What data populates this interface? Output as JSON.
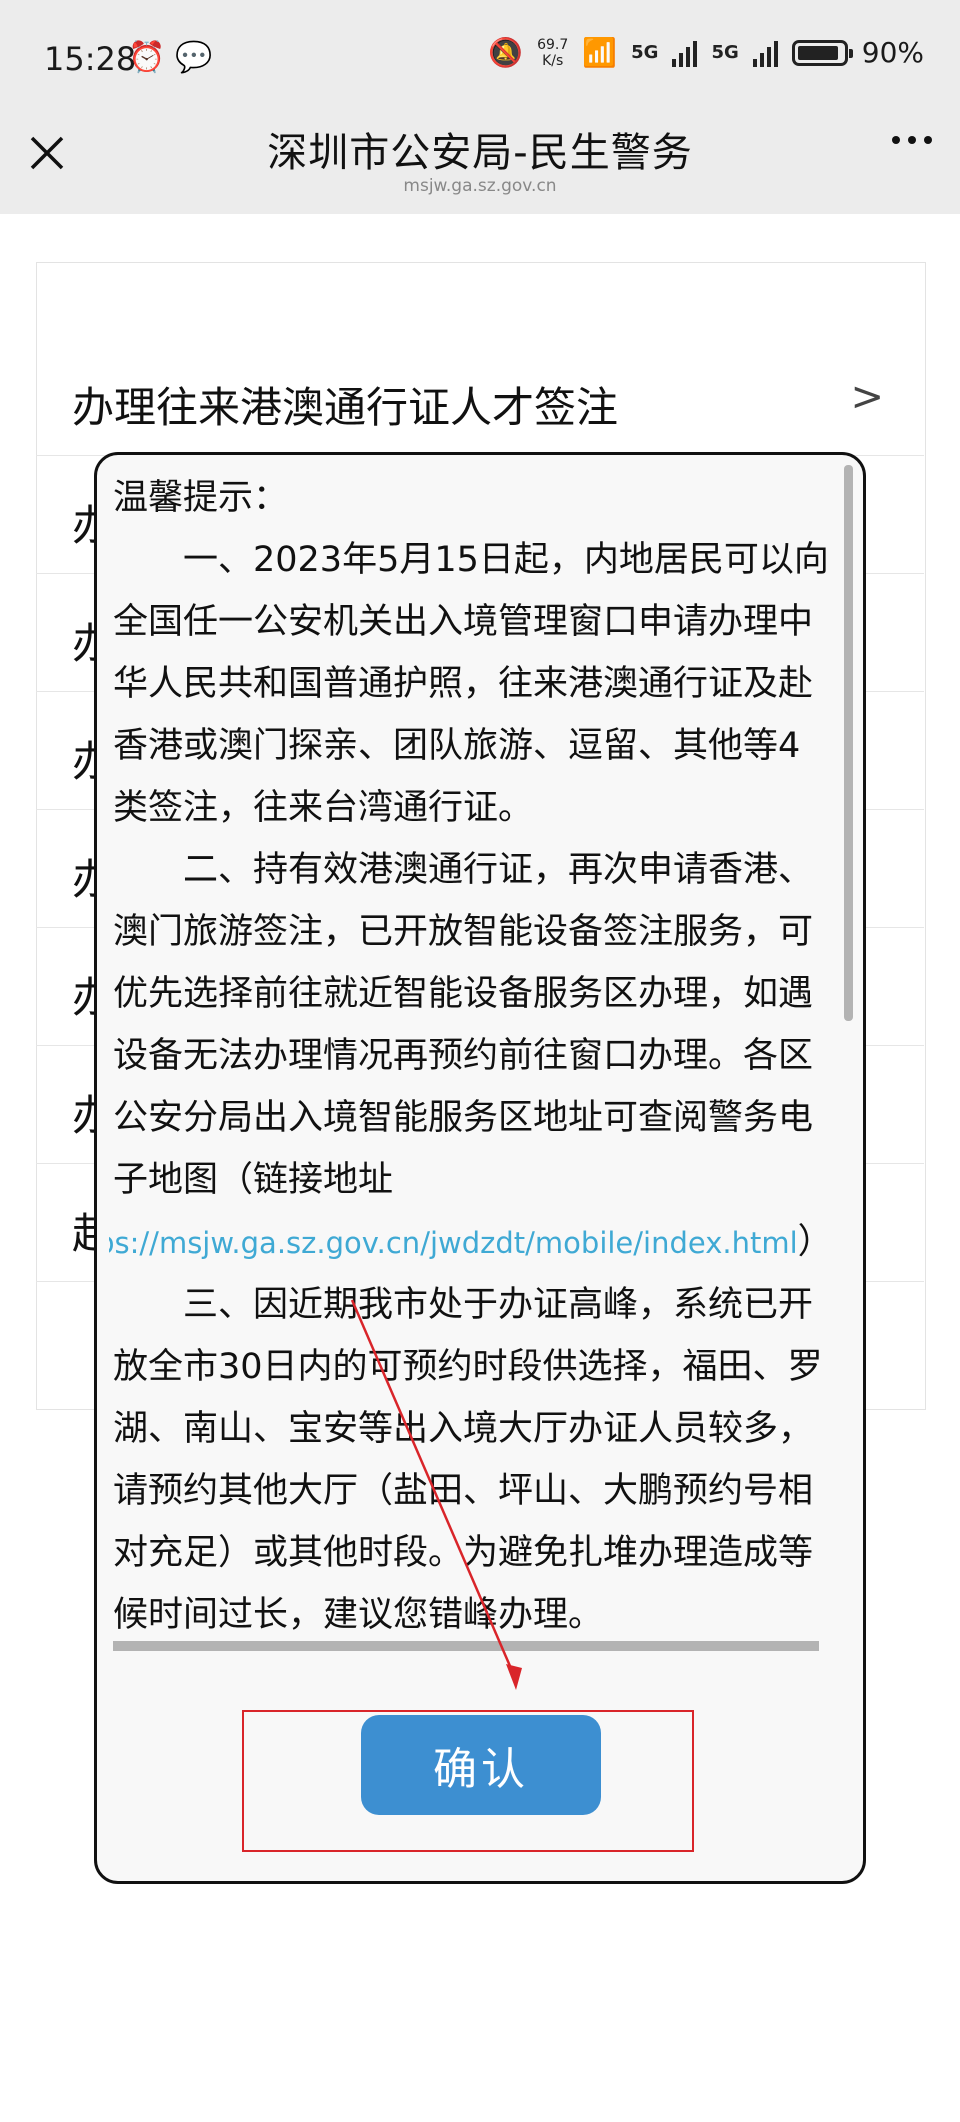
{
  "status_bar": {
    "time": "15:28",
    "left_icons": [
      "alarm-icon",
      "chat-bubble-icon"
    ],
    "speed_value": "69.7",
    "speed_unit": "K/s",
    "network_1": "5G",
    "network_2": "5G",
    "battery": "90%"
  },
  "nav": {
    "title": "深圳市公安局-民生警务",
    "url": "msjw.ga.sz.gov.cn",
    "close_icon": "close-icon",
    "more_icon": "more-icon"
  },
  "menu": {
    "items": [
      {
        "label": "办理往来港澳通行证人才签注",
        "chevron": ">"
      },
      {
        "label": "办",
        "chevron": ""
      },
      {
        "label": "办",
        "chevron": ""
      },
      {
        "label": "办",
        "chevron": ""
      },
      {
        "label": "办",
        "chevron": ""
      },
      {
        "label": "办",
        "chevron": ""
      },
      {
        "label": "办",
        "chevron": ""
      },
      {
        "label": "赴",
        "chevron": ""
      }
    ]
  },
  "modal": {
    "heading": "温馨提示：",
    "para1": "一、2023年5月15日起，内地居民可以向全国任一公安机关出入境管理窗口申请办理中华人民共和国普通护照，往来港澳通行证及赴香港或澳门探亲、团队旅游、逗留、其他等4类签注，往来台湾通行证。",
    "para2_a": "二、持有效港澳通行证，再次申请香港、澳门旅游签注，已开放智能设备签注服务，可优先选择前往就近智能设备服务区办理，如遇设备无法办理情况再预约前往窗口办理。各区公安分局出入境智能服务区地址可查阅警务电子地图（链接地址",
    "link": "https://msjw.ga.sz.gov.cn/jwdzdt/mobile/index.html",
    "para2_b": "）",
    "para3": "三、因近期我市处于办证高峰，系统已开放全市30日内的可预约时段供选择，福田、罗湖、南山、宝安等出入境大厅办证人员较多，请预约其他大厅（盐田、坪山、大鹏预约号相对充足）或其他时段。为避免扎堆办理造成等候时间过长，建议您错峰办理。",
    "confirm_label": "确认"
  },
  "annotation": {
    "color": "#d9252a"
  }
}
